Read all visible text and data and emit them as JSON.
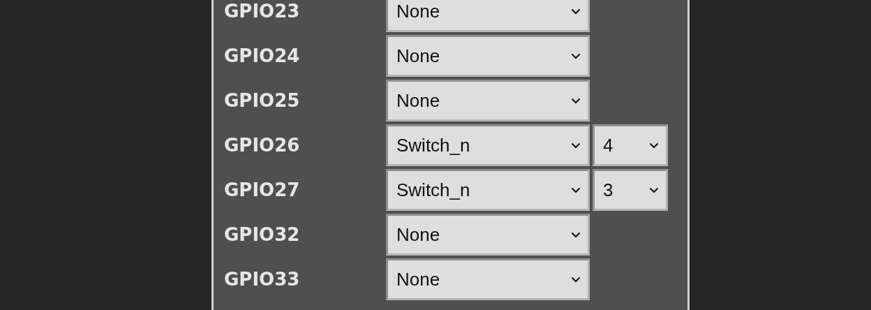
{
  "pins": [
    {
      "pin": "GPIO23",
      "function": "None"
    },
    {
      "pin": "GPIO24",
      "function": "None"
    },
    {
      "pin": "GPIO25",
      "function": "None"
    },
    {
      "pin": "GPIO26",
      "function": "Switch_n",
      "index": "4"
    },
    {
      "pin": "GPIO27",
      "function": "Switch_n",
      "index": "3"
    },
    {
      "pin": "GPIO32",
      "function": "None"
    },
    {
      "pin": "GPIO33",
      "function": "None"
    }
  ]
}
